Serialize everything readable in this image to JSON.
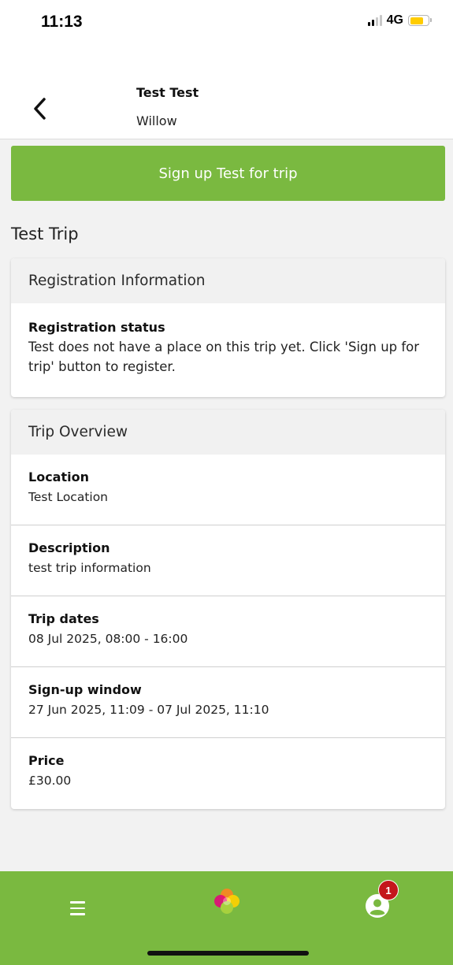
{
  "status_bar": {
    "time": "11:13",
    "network": "4G"
  },
  "header": {
    "title": "Test Test",
    "subtitle": "Willow",
    "back_icon": "chevron-left-icon"
  },
  "signup_button": {
    "label": "Sign up Test for trip"
  },
  "trip": {
    "title": "Test Trip"
  },
  "registration_card": {
    "header": "Registration Information",
    "status_label": "Registration status",
    "status_text": "Test does not have a place on this trip yet. Click 'Sign up for trip' button to register."
  },
  "overview_card": {
    "header": "Trip Overview",
    "fields": [
      {
        "label": "Location",
        "value": "Test Location"
      },
      {
        "label": "Description",
        "value": "test trip information"
      },
      {
        "label": "Trip dates",
        "value": "08 Jul 2025, 08:00 - 16:00"
      },
      {
        "label": "Sign-up window",
        "value": "27 Jun 2025, 11:09 - 07 Jul 2025, 11:10"
      },
      {
        "label": "Price",
        "value": "£30.00"
      }
    ]
  },
  "bottom_nav": {
    "menu_icon": "hamburger-menu-icon",
    "logo_icon": "clover-logo-icon",
    "profile_icon": "user-profile-icon",
    "notification_count": "1"
  },
  "colors": {
    "primary_green": "#7ab940",
    "badge_red": "#c4161c",
    "battery_yellow": "#ffcc00"
  }
}
